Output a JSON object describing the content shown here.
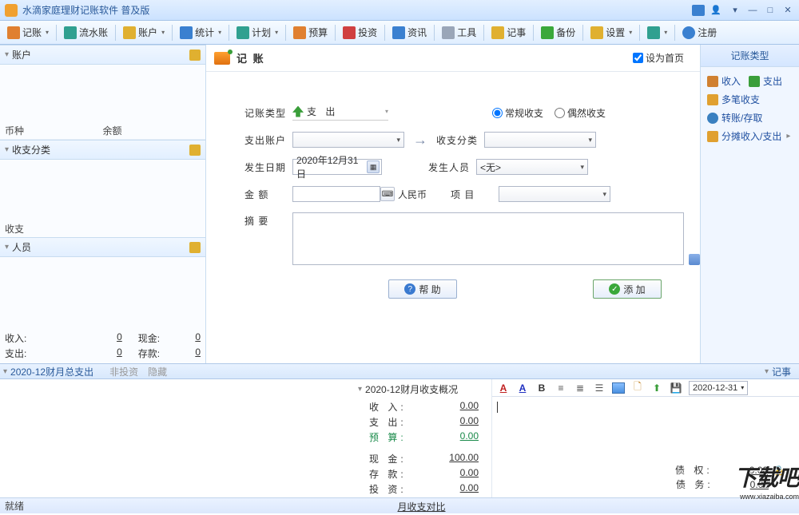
{
  "window": {
    "title": "水滴家庭理财记账软件 普及版"
  },
  "toolbar": [
    {
      "label": "记账",
      "has_drop": true,
      "color": "ic-orange"
    },
    {
      "label": "流水账",
      "has_drop": false,
      "color": "ic-teal"
    },
    {
      "label": "账户",
      "has_drop": true,
      "color": "ic-yellow"
    },
    {
      "label": "统计",
      "has_drop": true,
      "color": "ic-blue"
    },
    {
      "label": "计划",
      "has_drop": true,
      "color": "ic-teal"
    },
    {
      "label": "预算",
      "has_drop": false,
      "color": "ic-orange"
    },
    {
      "label": "投资",
      "has_drop": false,
      "color": "ic-red"
    },
    {
      "label": "资讯",
      "has_drop": false,
      "color": "ic-blue"
    },
    {
      "label": "工具",
      "has_drop": false,
      "color": "ic-gray"
    },
    {
      "label": "记事",
      "has_drop": false,
      "color": "ic-yellow"
    },
    {
      "label": "备份",
      "has_drop": false,
      "color": "ic-green"
    },
    {
      "label": "设置",
      "has_drop": true,
      "color": "ic-yellow"
    },
    {
      "label": "",
      "has_drop": true,
      "color": "ic-teal"
    },
    {
      "label": "注册",
      "has_drop": false,
      "color": "ic-blue"
    }
  ],
  "left": {
    "accounts": {
      "title": "账户",
      "col_currency": "币种",
      "col_balance": "余额"
    },
    "category": {
      "title": "收支分类",
      "rcvpay_label": "收支"
    },
    "person": {
      "title": "人员",
      "income_label": "收入:",
      "income_value": "0",
      "expense_label": "支出:",
      "expense_value": "0",
      "cash_label": "现金:",
      "cash_value": "0",
      "deposit_label": "存款:",
      "deposit_value": "0"
    }
  },
  "center": {
    "title": "记 账",
    "homepage_label": "设为首页",
    "labels": {
      "type": "记账类型",
      "account": "支出账户",
      "date": "发生日期",
      "amount": "金 额",
      "currency": "人民币",
      "summary": "摘 要",
      "category": "收支分类",
      "person": "发生人员",
      "project": "项 目"
    },
    "type_value": "支 出",
    "date_value": "2020年12月31日",
    "radio_normal": "常规收支",
    "radio_accidental": "偶然收支",
    "person_value": "<无>",
    "help_btn": "帮 助",
    "add_btn": "添 加"
  },
  "right": {
    "title": "记账类型",
    "items": [
      {
        "label": "收入",
        "cls": "in"
      },
      {
        "label": "支出",
        "cls": "out"
      },
      {
        "label": "多笔收支",
        "cls": "multi"
      },
      {
        "label": "转账/存取",
        "cls": "trans"
      },
      {
        "label": "分摊收入/支出",
        "cls": "split",
        "arrow": true
      }
    ]
  },
  "footer": {
    "bar_title": "2020-12财月总支出",
    "tab_noninvest": "非投资",
    "tab_hidden": "隐藏",
    "journal_label": "记事",
    "overview_title": "2020-12财月收支概况",
    "stats": {
      "income_k": "收 入:",
      "income_v": "0.00",
      "expense_k": "支 出:",
      "expense_v": "0.00",
      "budget_k": "预 算:",
      "budget_v": "0.00",
      "cash_k": "现 金:",
      "cash_v": "100.00",
      "deposit_k": "存 款:",
      "deposit_v": "0.00",
      "invest_k": "投 资:",
      "invest_v": "0.00"
    },
    "compare_link": "月收支对比",
    "debt": {
      "receivable_k": "债 权:",
      "receivable_v": "0.00",
      "payable_k": "债 务:",
      "payable_v": "0.00"
    },
    "date_picker": "2020-12-31"
  },
  "status": {
    "ready": "就绪"
  },
  "watermark": {
    "main": "下载吧",
    "sub": "www.xiazaiba.com"
  }
}
